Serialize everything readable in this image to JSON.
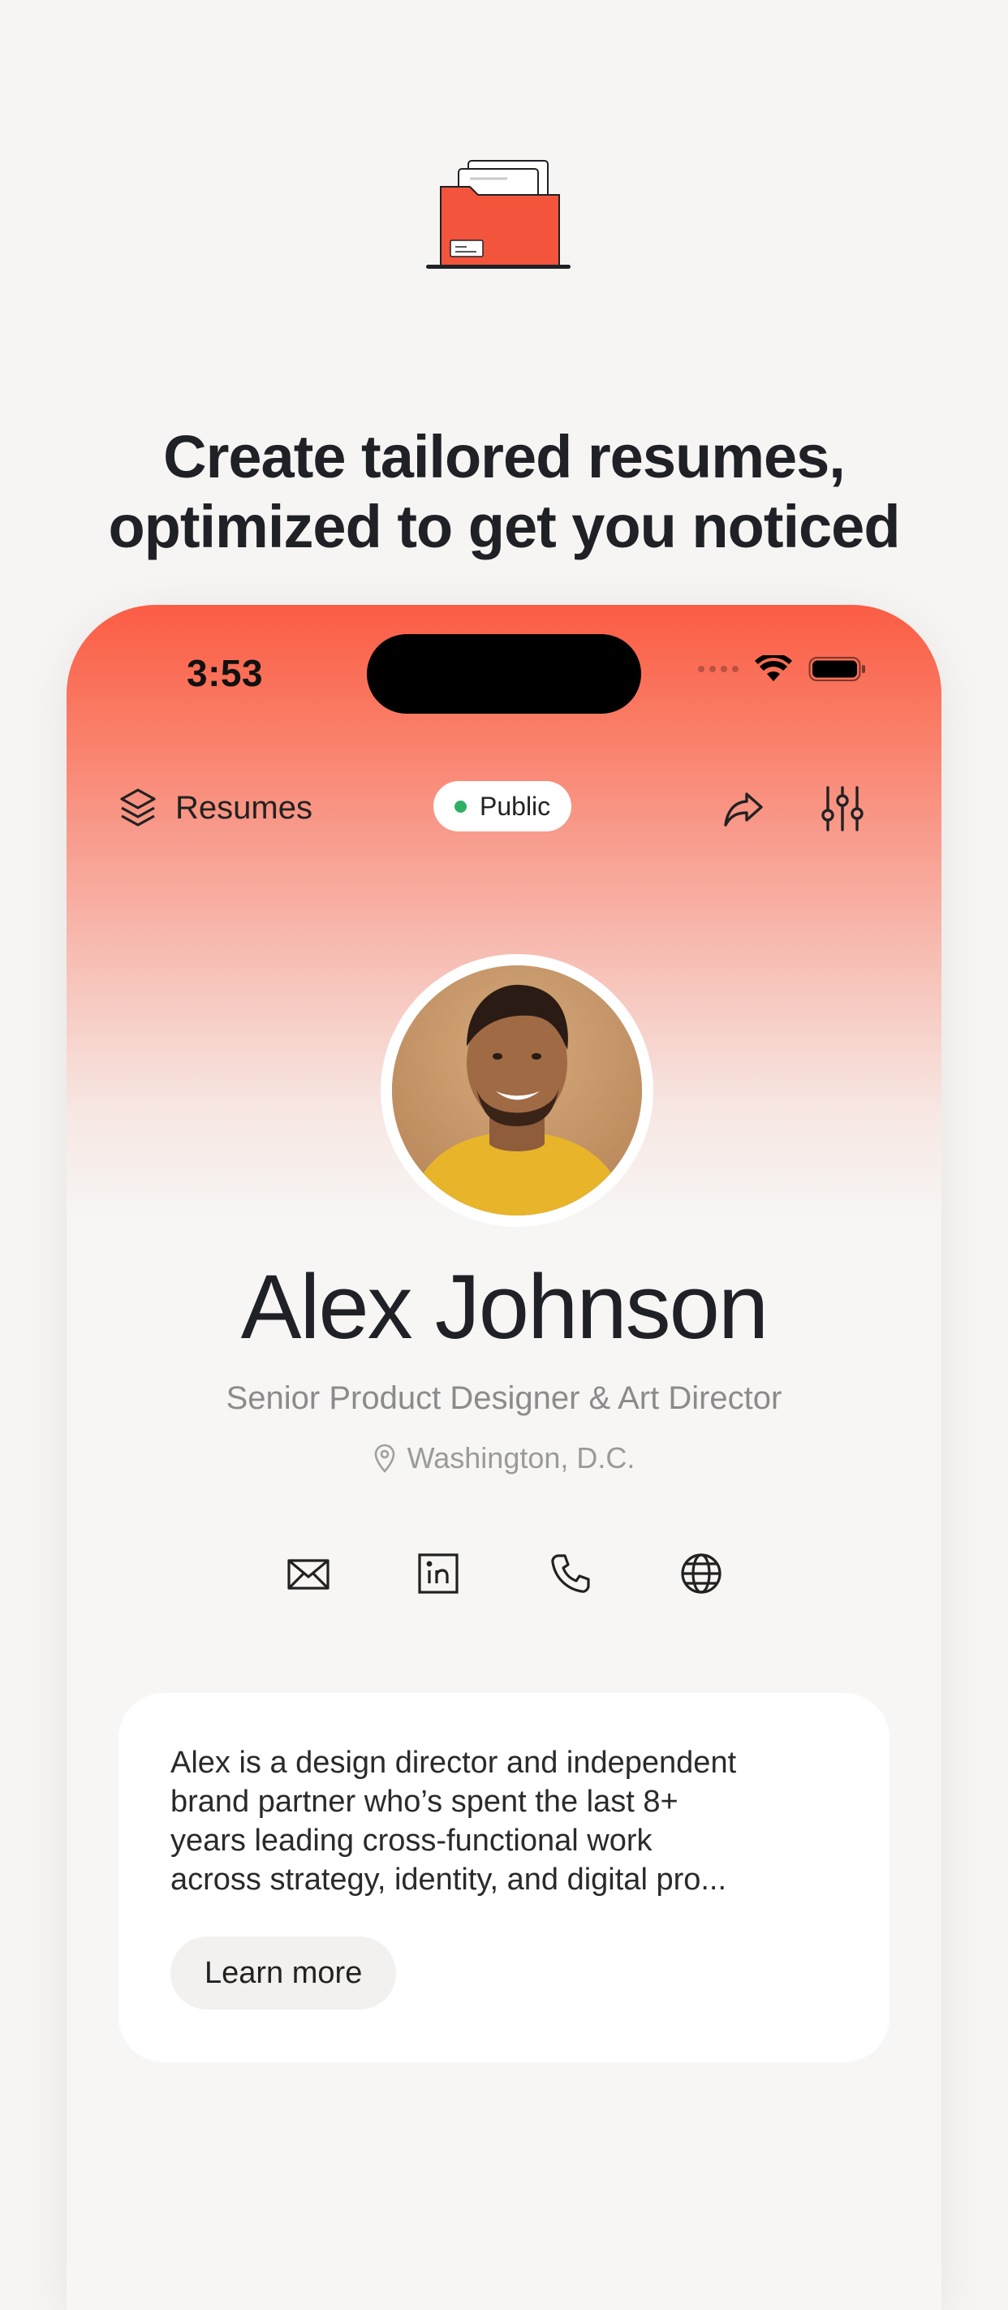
{
  "headline": {
    "line1": "Create tailored resumes,",
    "line2": "optimized to get you noticed"
  },
  "hero_icon": "folder-with-documents-icon",
  "status_bar": {
    "time": "3:53",
    "icons": [
      "cellular-icon",
      "wifi-icon",
      "battery-icon"
    ]
  },
  "nav": {
    "resumes_label": "Resumes",
    "visibility_label": "Public",
    "visibility_color": "#2db064",
    "icons": [
      "layers-icon",
      "share-icon",
      "sliders-icon"
    ]
  },
  "profile": {
    "name": "Alex Johnson",
    "title": "Senior Product Designer & Art Director",
    "location": "Washington, D.C."
  },
  "contact_icons": [
    "mail-icon",
    "linkedin-icon",
    "phone-icon",
    "globe-icon"
  ],
  "bio": {
    "line1": "Alex is a design director and independent",
    "line2": "brand partner who’s spent the last 8+",
    "line3": "years leading cross-functional work",
    "line4": "across strategy, identity, and digital pro...",
    "button_label": "Learn more"
  },
  "colors": {
    "accent": "#fb5c44",
    "background": "#f6f5f3",
    "text": "#1f2126",
    "muted": "#8b8b8b"
  }
}
